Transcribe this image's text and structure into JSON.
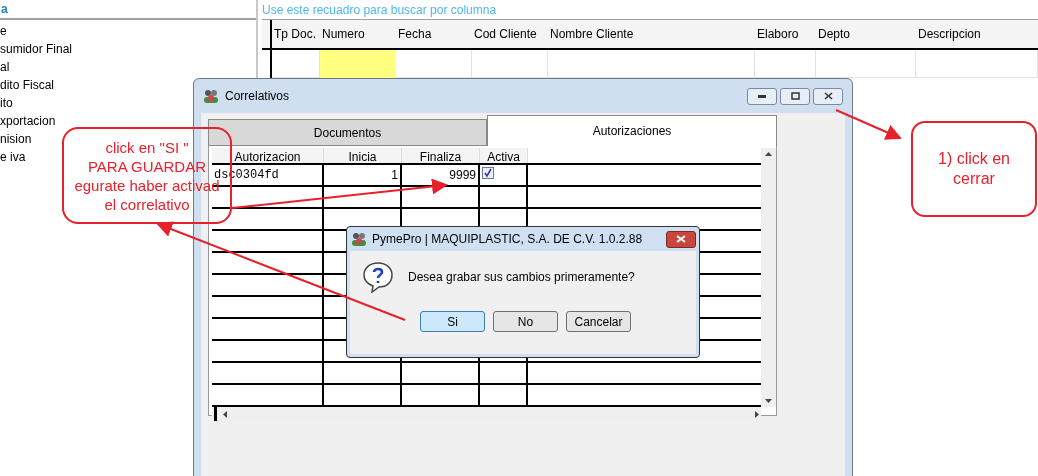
{
  "left_panel": {
    "heading": "a",
    "items": [
      "e",
      "sumidor Final",
      "al",
      "dito Fiscal",
      "ito",
      "xportacion",
      "nision",
      "e iva"
    ]
  },
  "search_hint": "Use este recuadro para buscar por columna",
  "grid": {
    "columns": [
      {
        "label": "Tp Doc.",
        "selected": false
      },
      {
        "label": "Numero",
        "selected": true
      },
      {
        "label": "Fecha",
        "selected": false
      },
      {
        "label": "Cod Cliente",
        "selected": false
      },
      {
        "label": "Nombre Cliente",
        "selected": false
      },
      {
        "label": "Elaboro",
        "selected": false
      },
      {
        "label": "Depto",
        "selected": false
      },
      {
        "label": "Descripcion",
        "selected": false
      }
    ]
  },
  "correlativos": {
    "title": "Correlativos",
    "tabs": [
      {
        "label": "Documentos",
        "selected": false
      },
      {
        "label": "Autorizaciones",
        "selected": true
      }
    ],
    "table": {
      "columns": [
        "Autorizacion",
        "Inicia",
        "Finaliza",
        "Activa"
      ],
      "rows": [
        {
          "autorizacion": "dsc0304fd",
          "inicia": "1",
          "finaliza": "9999",
          "activa": true
        }
      ]
    }
  },
  "dialog": {
    "title": "PymePro | MAQUIPLASTIC, S.A. DE C.V. 1.0.2.88",
    "message": "Desea grabar sus cambios primeramente?",
    "buttons": [
      {
        "label": "Si",
        "selected": true
      },
      {
        "label": "No",
        "selected": false
      },
      {
        "label": "Cancelar",
        "selected": false
      }
    ]
  },
  "annotations": [
    {
      "lines": [
        "click en \"SI \"",
        "PARA GUARDAR",
        "egurate haber activad",
        "el correlativo"
      ]
    },
    {
      "lines": [
        "1) click en",
        "cerrar"
      ]
    }
  ]
}
